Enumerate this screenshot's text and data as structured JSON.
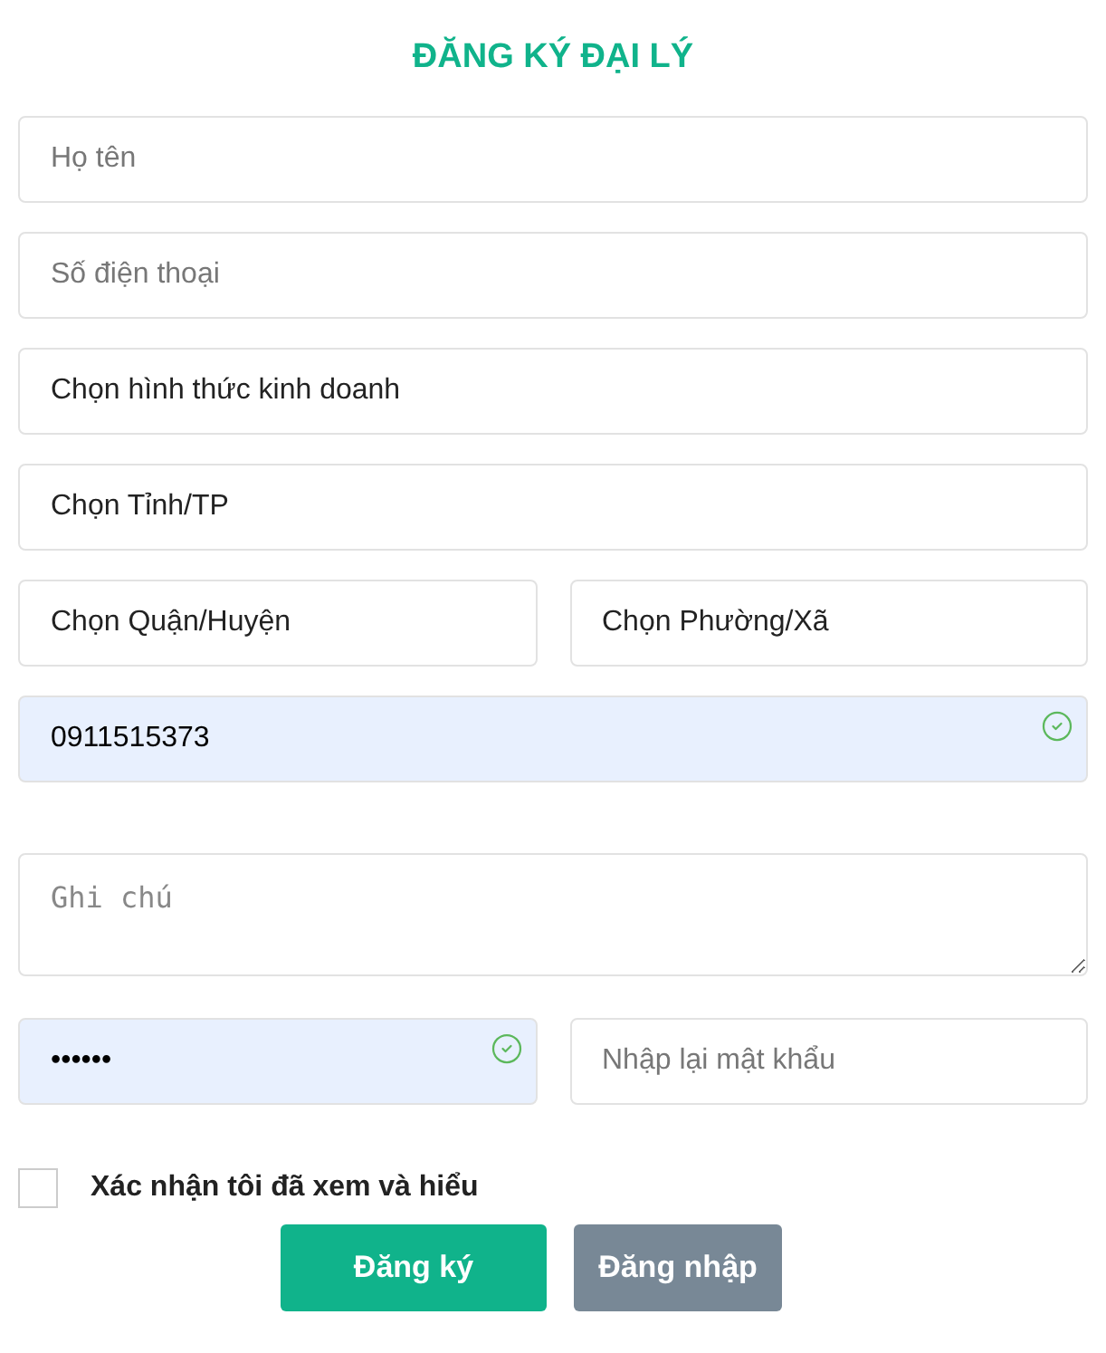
{
  "title": "ĐĂNG KÝ ĐẠI LÝ",
  "rows": [
    {
      "fields": [
        {
          "kind": "input",
          "placeholder": "Họ tên",
          "valid": false
        }
      ]
    },
    {
      "fields": [
        {
          "kind": "input",
          "placeholder": "Số điện thoại",
          "valid": false
        }
      ]
    },
    {
      "fields": [
        {
          "kind": "select",
          "value": "Chọn hình thức kinh doanh",
          "valid": false
        }
      ]
    },
    {
      "fields": [
        {
          "kind": "select",
          "value": "Chọn Tỉnh/TP",
          "valid": false
        }
      ]
    },
    {
      "fields": [
        {
          "kind": "select",
          "value": "Chọn Quận/Huyện",
          "valid": false
        },
        {
          "kind": "select",
          "value": "Chọn Phường/Xã",
          "valid": false
        }
      ]
    },
    {
      "fields": [
        {
          "kind": "input",
          "value": "0911515373",
          "valid": true
        }
      ]
    },
    {
      "fields": [
        {
          "kind": "textarea",
          "placeholder": "Ghi chú",
          "valid": false
        }
      ]
    },
    {
      "fields": [
        {
          "kind": "input",
          "value": "••••••",
          "valid": true
        },
        {
          "kind": "input",
          "placeholder": "Nhập lại mật khẩu",
          "valid": false
        }
      ]
    }
  ],
  "agree": {
    "label": "Xác nhận tôi đã xem và hiểu",
    "checked": false
  },
  "buttons": [
    {
      "label": "Đăng ký",
      "kind": "primary"
    },
    {
      "label": "Đăng nhập",
      "kind": "secondary"
    }
  ]
}
